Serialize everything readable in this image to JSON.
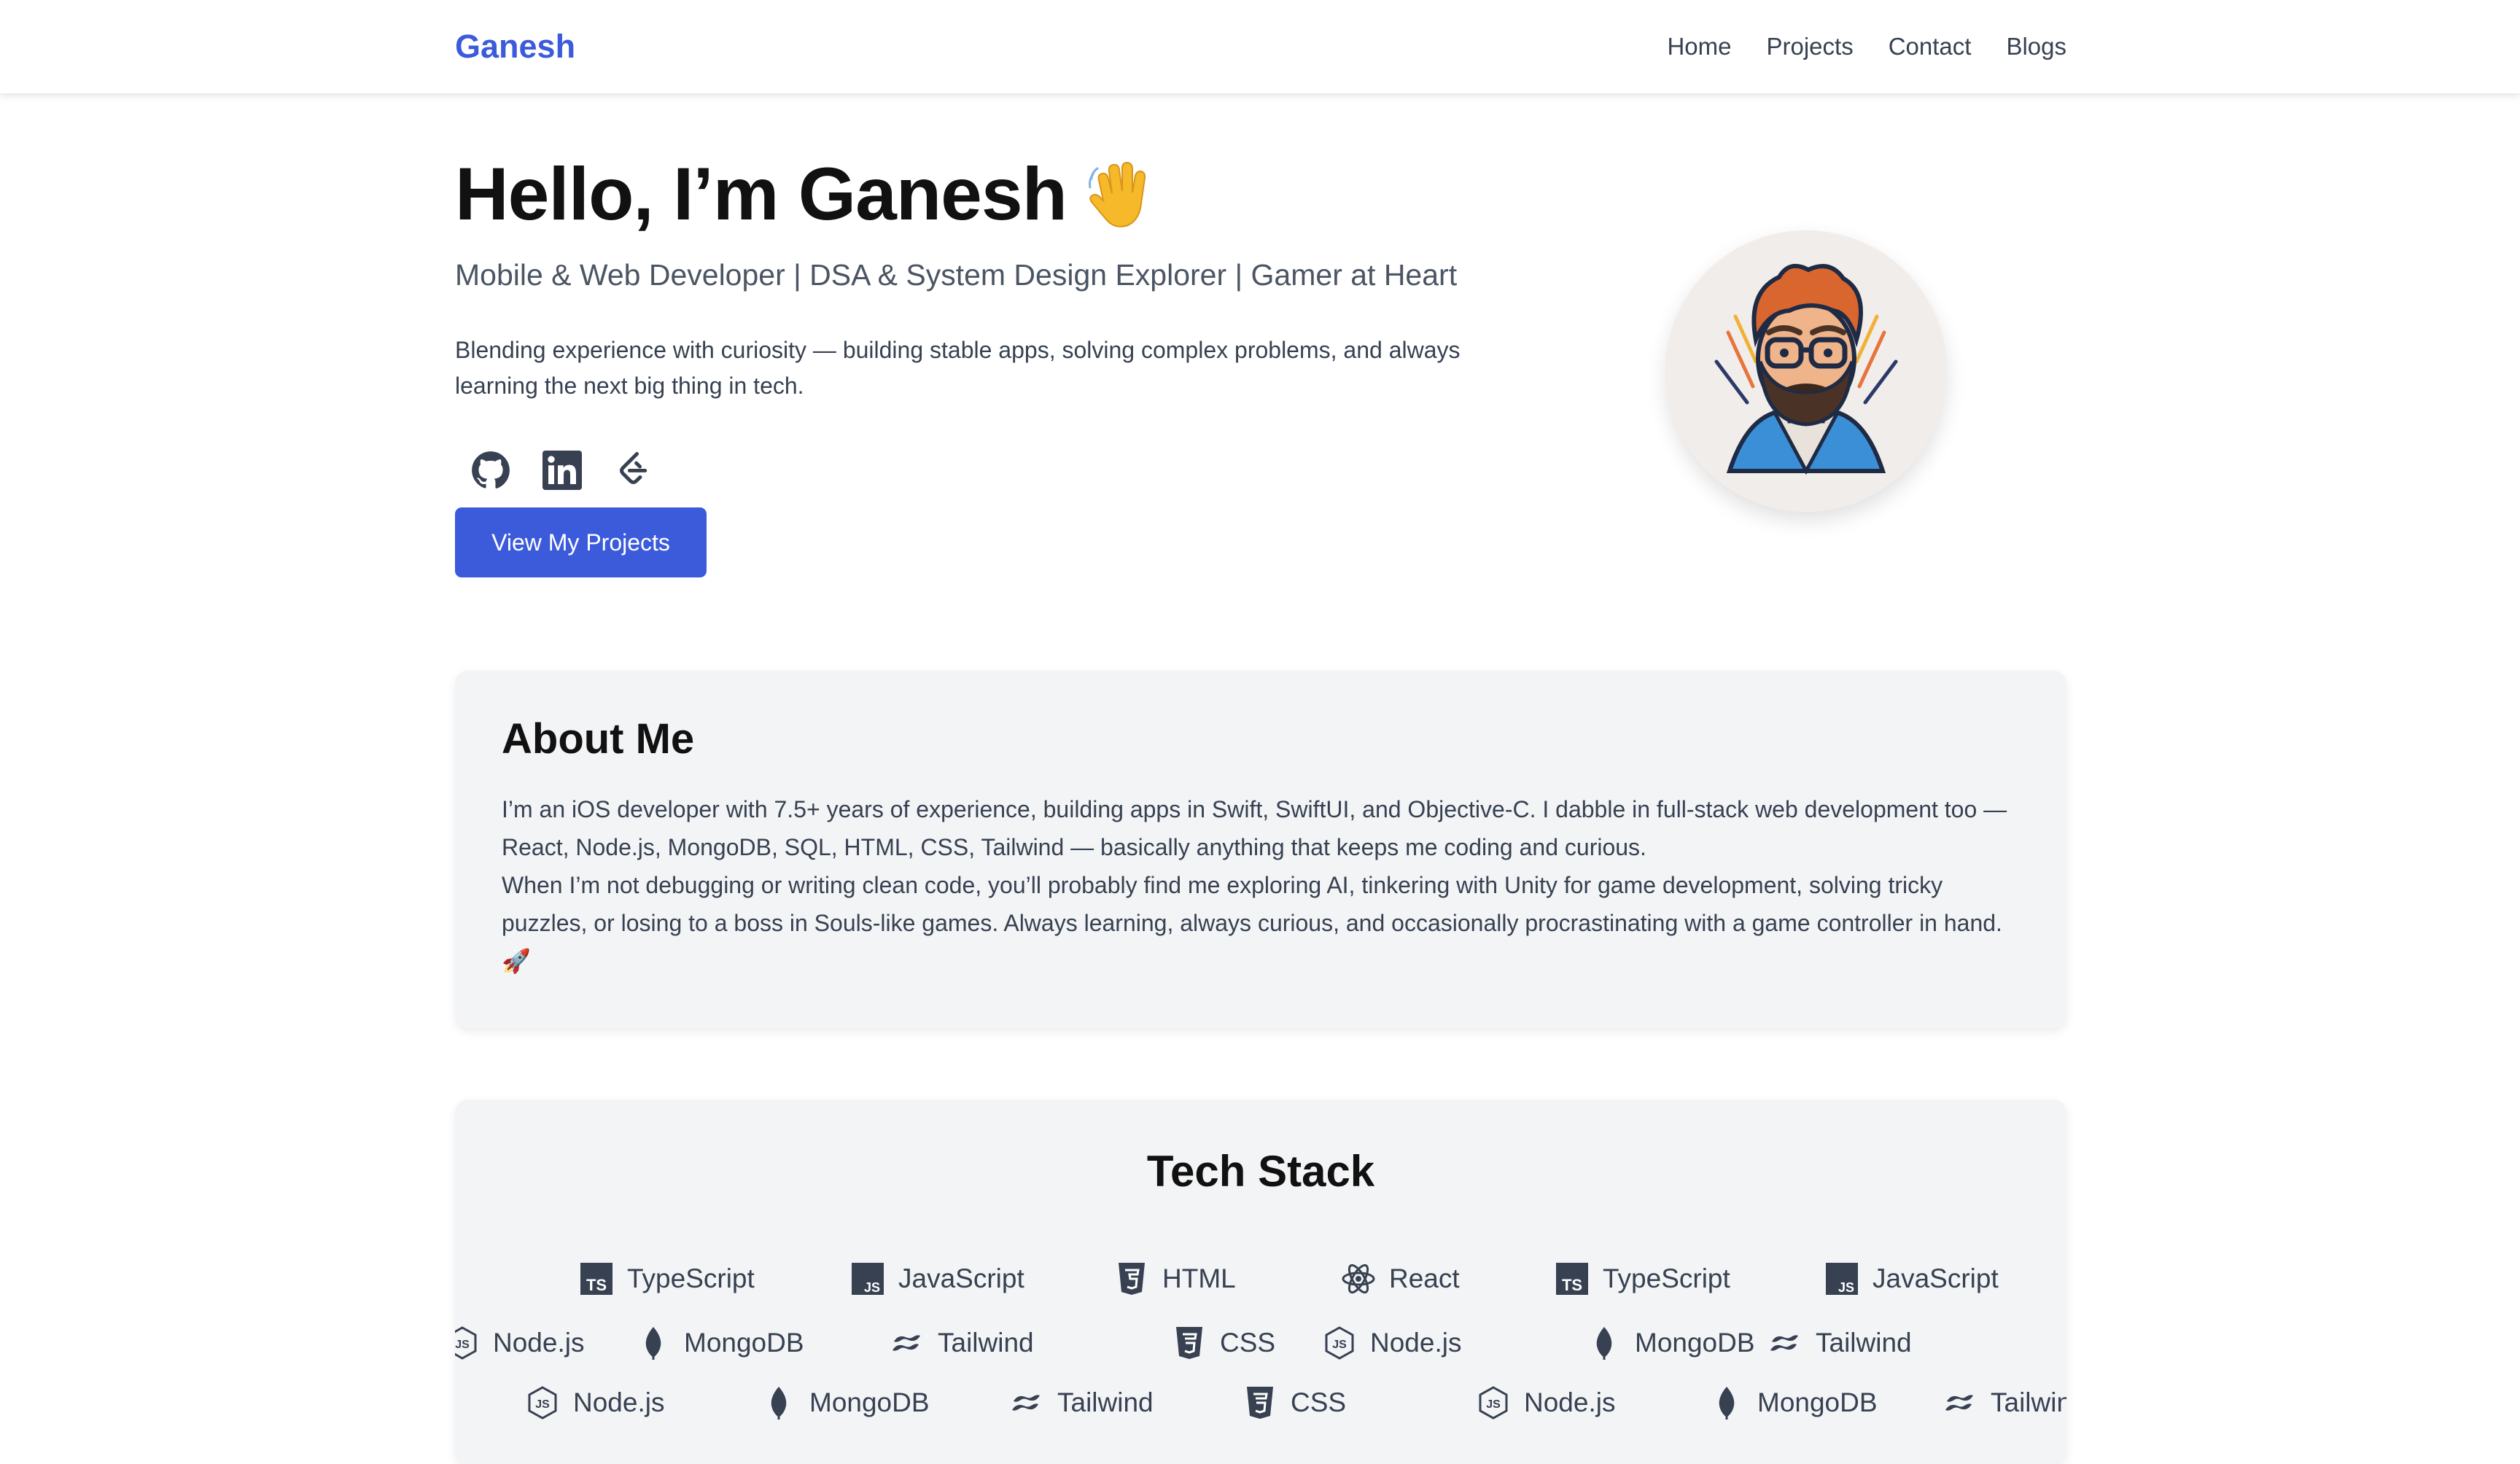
{
  "nav": {
    "brand": "Ganesh",
    "links": [
      "Home",
      "Projects",
      "Contact",
      "Blogs"
    ]
  },
  "hero": {
    "title": "Hello, I’m Ganesh",
    "subtitle": "Mobile & Web Developer | DSA & System Design Explorer | Gamer at Heart",
    "description": "Blending experience with curiosity — building stable apps, solving complex problems, and always learning the next big thing in tech.",
    "socials": [
      "github-icon",
      "linkedin-icon",
      "leetcode-icon"
    ],
    "cta_label": "View My Projects"
  },
  "about": {
    "title": "About Me",
    "paragraph1": "I’m an iOS developer with 7.5+ years of experience, building apps in Swift, SwiftUI, and Objective-C. I dabble in full-stack web development too — React, Node.js, MongoDB, SQL, HTML, CSS, Tailwind — basically anything that keeps me coding and curious.",
    "paragraph2": "When I’m not debugging or writing clean code, you’ll probably find me exploring AI, tinkering with Unity for game development, solving tricky puzzles, or losing to a boss in Souls-like games. Always learning, always curious, and occasionally procrastinating with a game controller in hand. 🚀"
  },
  "tech": {
    "title": "Tech Stack",
    "row1": [
      {
        "label": "TypeScript",
        "icon": "typescript-icon"
      },
      {
        "label": "JavaScript",
        "icon": "javascript-icon"
      },
      {
        "label": "HTML",
        "icon": "html-icon"
      },
      {
        "label": "React",
        "icon": "react-icon"
      },
      {
        "label": "TypeScript",
        "icon": "typescript-icon"
      },
      {
        "label": "JavaScript",
        "icon": "javascript-icon"
      }
    ],
    "row2": [
      {
        "label": "Node.js",
        "icon": "nodejs-icon"
      },
      {
        "label": "MongoDB",
        "icon": "mongodb-icon"
      },
      {
        "label": "Tailwind",
        "icon": "tailwind-icon"
      },
      {
        "label": "CSS",
        "icon": "css-icon"
      },
      {
        "label": "Node.js",
        "icon": "nodejs-icon"
      },
      {
        "label": "MongoDB",
        "icon": "mongodb-icon"
      },
      {
        "label": "Tailwind",
        "icon": "tailwind-icon"
      }
    ]
  },
  "colors": {
    "accent": "#3b5bdb",
    "card_bg": "#f3f4f6",
    "text": "#374151"
  }
}
